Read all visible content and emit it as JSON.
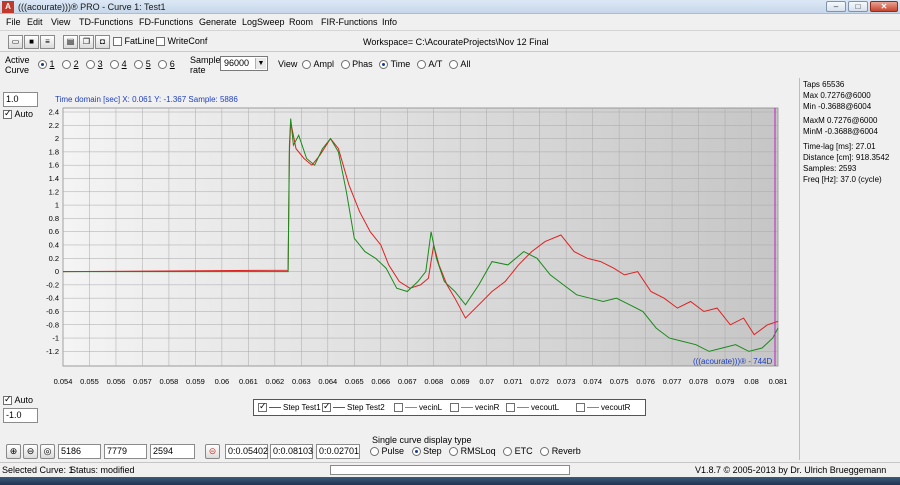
{
  "window": {
    "title": "(((acourate)))® PRO - Curve 1: Test1",
    "icon_name": "acourate-app-icon"
  },
  "menu": [
    "File",
    "Edit",
    "View",
    "TD-Functions",
    "FD-Functions",
    "Generate",
    "LogSweep",
    "Room",
    "FIR-Functions",
    "Info"
  ],
  "toolbar": {
    "fatline_label": "FatLine",
    "writeconf_label": "WriteConf",
    "workspace_text": "Workspace= C:\\AcourateProjects\\Nov 12 Final"
  },
  "controls": {
    "active_curve_label1": "Active",
    "active_curve_label2": "Curve",
    "curves": [
      "1",
      "2",
      "3",
      "4",
      "5",
      "6"
    ],
    "active_curve_selected": "1",
    "sample_rate_label1": "Sample",
    "sample_rate_label2": "rate",
    "sample_rate_value": "96000",
    "view_label": "View",
    "view_options": [
      "Ampl",
      "Phas",
      "Time",
      "A/T",
      "All"
    ],
    "view_selected": "Time"
  },
  "plot": {
    "y_top_value": "1.0",
    "y_bottom_value": "-1.0",
    "auto_label": "Auto",
    "status_line": "Time domain [sec]   X: 0.061   Y: -1.367   Sample: 5886",
    "watermark": "(((acourate)))® - 744D"
  },
  "info": {
    "taps": "Taps 65536",
    "max": "Max 0.7276@6000",
    "min": "Min -0.3688@6004",
    "maxm": "MaxM 0.7276@6000",
    "minm": "MinM -0.3688@6004",
    "timelag": "Time-lag [ms]: 27.01",
    "distance": "Distance [cm]: 918.3542",
    "samples": "Samples:  2593",
    "freq": "Freq [Hz]: 37.0 (cycle)"
  },
  "legend": {
    "items": [
      {
        "label": "Step Test1",
        "checked": true,
        "color": "#e02020"
      },
      {
        "label": "Step Test2",
        "checked": true,
        "color": "#1a8a1a"
      },
      {
        "label": "vecinL",
        "checked": false,
        "color": "#c08040"
      },
      {
        "label": "vecinR",
        "checked": false,
        "color": "#888888"
      },
      {
        "label": "vecoutL",
        "checked": false,
        "color": "#888888"
      },
      {
        "label": "vecoutR",
        "checked": false,
        "color": "#888888"
      }
    ]
  },
  "bottom": {
    "field1": "5186",
    "field2": "7779",
    "field3": "2594",
    "time1": "0:0.05402",
    "time2": "0:0.08103",
    "time3": "0:0.02701",
    "display_type_label": "Single curve display type",
    "display_types": [
      "Pulse",
      "Step",
      "RMSLoq",
      "ETC",
      "Reverb"
    ],
    "display_selected": "Step"
  },
  "status": {
    "selected": "Selected Curve: 1",
    "state": "Status: modified",
    "version": "V1.8.7 © 2005-2013 by Dr. Ulrich Brueggemann"
  },
  "colors": {
    "plot_bg_left": "#f4f4f4",
    "plot_bg_right": "#c8c8c8",
    "cursor_line": "#c020c0",
    "series1": "#e02020",
    "series2": "#1a8a1a",
    "accent_text": "#1f3fbf"
  },
  "chart_data": {
    "type": "line",
    "xlim": [
      0.054,
      0.081
    ],
    "ylim": [
      -1.3,
      2.4
    ],
    "x_ticks": [
      "0.054",
      "0.055",
      "0.056",
      "0.057",
      "0.058",
      "0.059",
      "0.06",
      "0.061",
      "0.062",
      "0.063",
      "0.064",
      "0.065",
      "0.066",
      "0.067",
      "0.068",
      "0.069",
      "0.07",
      "0.071",
      "0.072",
      "0.073",
      "0.074",
      "0.075",
      "0.076",
      "0.077",
      "0.078",
      "0.079",
      "0.08",
      "0.081"
    ],
    "y_ticks": [
      "2.4",
      "2.2",
      "2",
      "1.8",
      "1.6",
      "1.4",
      "1.2",
      "1",
      "0.8",
      "0.6",
      "0.4",
      "0.2",
      "0",
      "-0.2",
      "-0.4",
      "-0.6",
      "-0.8",
      "-1",
      "-1.2"
    ],
    "series": [
      {
        "name": "Step Test1",
        "x": [
          0.054,
          0.0625,
          0.06255,
          0.0626,
          0.0628,
          0.0631,
          0.0634,
          0.0637,
          0.0641,
          0.0644,
          0.0648,
          0.0652,
          0.0656,
          0.066,
          0.0663,
          0.0667,
          0.0671,
          0.0675,
          0.0678,
          0.068,
          0.0682,
          0.0685,
          0.0688,
          0.0692,
          0.0697,
          0.0702,
          0.0707,
          0.0712,
          0.0717,
          0.0722,
          0.0728,
          0.0733,
          0.0738,
          0.0743,
          0.0748,
          0.0752,
          0.0757,
          0.0762,
          0.0767,
          0.0772,
          0.0777,
          0.0782,
          0.0787,
          0.0792,
          0.0797,
          0.0801,
          0.0806,
          0.081
        ],
        "y": [
          0,
          0.02,
          1.8,
          2.25,
          1.85,
          1.7,
          1.6,
          1.75,
          2.0,
          1.85,
          1.3,
          0.9,
          0.6,
          0.4,
          0.1,
          -0.15,
          -0.25,
          -0.2,
          -0.1,
          0.4,
          0.1,
          -0.2,
          -0.4,
          -0.7,
          -0.5,
          -0.3,
          -0.15,
          0.1,
          0.3,
          0.45,
          0.55,
          0.3,
          0.2,
          0.15,
          0.05,
          -0.05,
          0.0,
          -0.3,
          -0.4,
          -0.55,
          -0.45,
          -0.6,
          -0.55,
          -0.8,
          -0.7,
          -0.95,
          -0.8,
          -0.75
        ]
      },
      {
        "name": "Step Test2",
        "x": [
          0.054,
          0.0625,
          0.06255,
          0.0626,
          0.0627,
          0.0629,
          0.0632,
          0.0635,
          0.0638,
          0.0641,
          0.0644,
          0.0647,
          0.065,
          0.0654,
          0.0658,
          0.0662,
          0.0666,
          0.067,
          0.0674,
          0.0677,
          0.0679,
          0.0681,
          0.0684,
          0.0688,
          0.0692,
          0.0697,
          0.0702,
          0.0708,
          0.0714,
          0.0719,
          0.0724,
          0.0729,
          0.0734,
          0.0739,
          0.0744,
          0.0749,
          0.0754,
          0.0759,
          0.0764,
          0.0769,
          0.0774,
          0.0779,
          0.0784,
          0.0789,
          0.0794,
          0.0799,
          0.0804,
          0.0808,
          0.081
        ],
        "y": [
          0,
          0.0,
          1.9,
          2.3,
          1.9,
          2.05,
          1.7,
          1.6,
          1.85,
          2.0,
          1.8,
          1.2,
          0.5,
          0.3,
          0.2,
          0.05,
          -0.25,
          -0.3,
          -0.15,
          0.0,
          0.6,
          0.2,
          -0.15,
          -0.3,
          -0.5,
          -0.2,
          0.15,
          0.1,
          0.3,
          0.2,
          -0.05,
          -0.2,
          -0.35,
          -0.4,
          -0.45,
          -0.4,
          -0.5,
          -0.6,
          -0.85,
          -1.0,
          -1.05,
          -1.1,
          -1.2,
          -1.15,
          -1.1,
          -1.2,
          -1.15,
          -1.0,
          -0.85
        ]
      }
    ]
  }
}
